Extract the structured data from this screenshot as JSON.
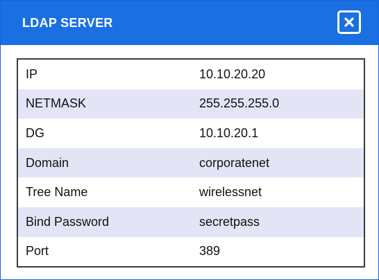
{
  "dialog": {
    "title": "LDAP SERVER",
    "close_icon": "close-icon",
    "colors": {
      "titlebar": "#1a6fe3",
      "row_alt": "#e4e4f7"
    }
  },
  "rows": [
    {
      "label": "IP",
      "value": "10.10.20.20"
    },
    {
      "label": "NETMASK",
      "value": "255.255.255.0"
    },
    {
      "label": "DG",
      "value": "10.10.20.1"
    },
    {
      "label": "Domain",
      "value": "corporatenet"
    },
    {
      "label": "Tree Name",
      "value": "wirelessnet"
    },
    {
      "label": "Bind Password",
      "value": "secretpass"
    },
    {
      "label": "Port",
      "value": "389"
    }
  ]
}
